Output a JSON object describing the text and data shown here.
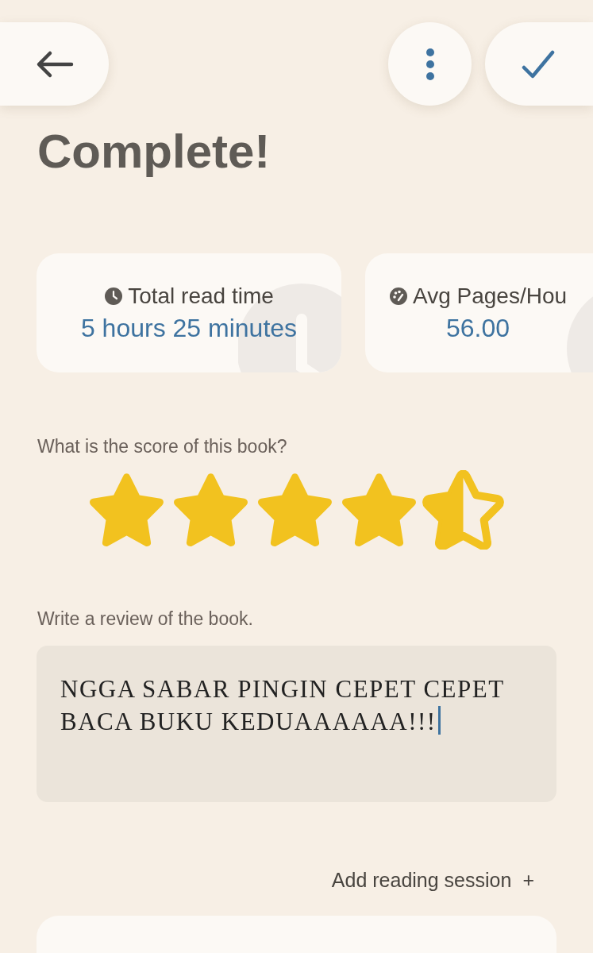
{
  "title": "Complete!",
  "stats": [
    {
      "kind": "time",
      "label": "Total read time",
      "value": "5 hours 25 minutes"
    },
    {
      "kind": "speed",
      "label": "Avg Pages/Hou",
      "value": "56.00"
    }
  ],
  "rating": {
    "prompt": "What is the score of this book?",
    "stars": 4.5
  },
  "review": {
    "prompt": "Write a review of the book.",
    "value": "NGGA SABAR PINGIN CEPET CEPET BACA BUKU KEDUAAAAAA!!!"
  },
  "add_session": {
    "label": "Add reading session",
    "icon": "+"
  }
}
